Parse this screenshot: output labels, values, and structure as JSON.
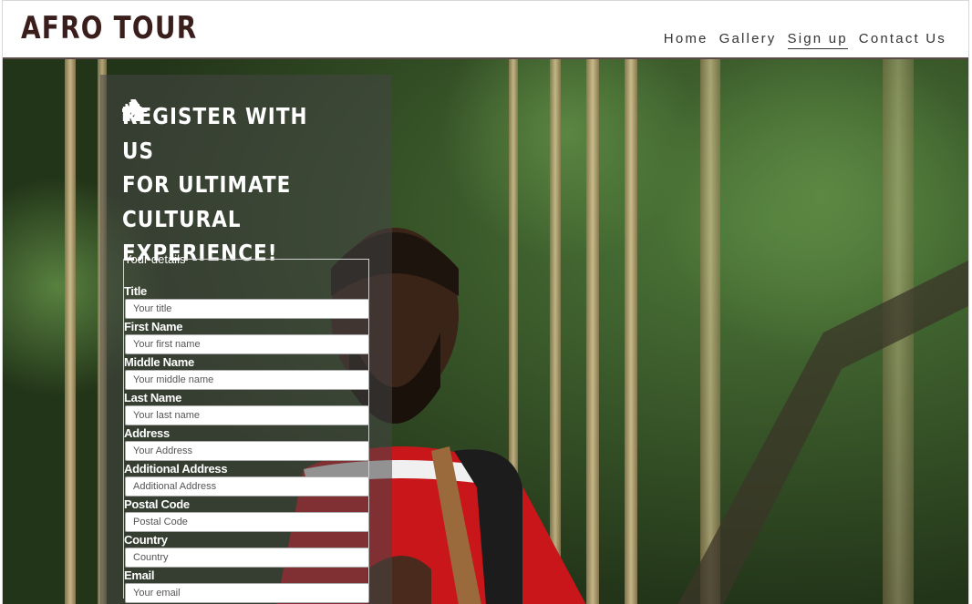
{
  "header": {
    "logo": "AFRO TOUR",
    "nav": [
      {
        "label": "Home",
        "active": false
      },
      {
        "label": "Gallery",
        "active": false
      },
      {
        "label": "Sign up",
        "active": true
      },
      {
        "label": "Contact Us",
        "active": false
      }
    ]
  },
  "panel": {
    "title_lines": [
      "REGISTER WITH US",
      "FOR ULTIMATE",
      "CULTURAL",
      "EXPERIENCE!"
    ],
    "title_icon_left": "castle-icon",
    "title_icon_right": "airplane-icon"
  },
  "form": {
    "legend": "Your details",
    "fields": [
      {
        "label": "Title",
        "placeholder": "Your title"
      },
      {
        "label": "First Name",
        "placeholder": "Your first name"
      },
      {
        "label": "Middle Name",
        "placeholder": "Your middle name"
      },
      {
        "label": "Last Name",
        "placeholder": "Your last name"
      },
      {
        "label": "Address",
        "placeholder": "Your Address"
      },
      {
        "label": "Additional Address",
        "placeholder": "Additional Address"
      },
      {
        "label": "Postal Code",
        "placeholder": "Postal Code"
      },
      {
        "label": "Country",
        "placeholder": "Country"
      },
      {
        "label": "Email",
        "placeholder": "Your email"
      }
    ]
  },
  "colors": {
    "logo": "#3a1e1c",
    "nav_text": "#333333",
    "panel_bg": "rgba(70,70,70,0.55)",
    "title_text": "#ffffff"
  }
}
